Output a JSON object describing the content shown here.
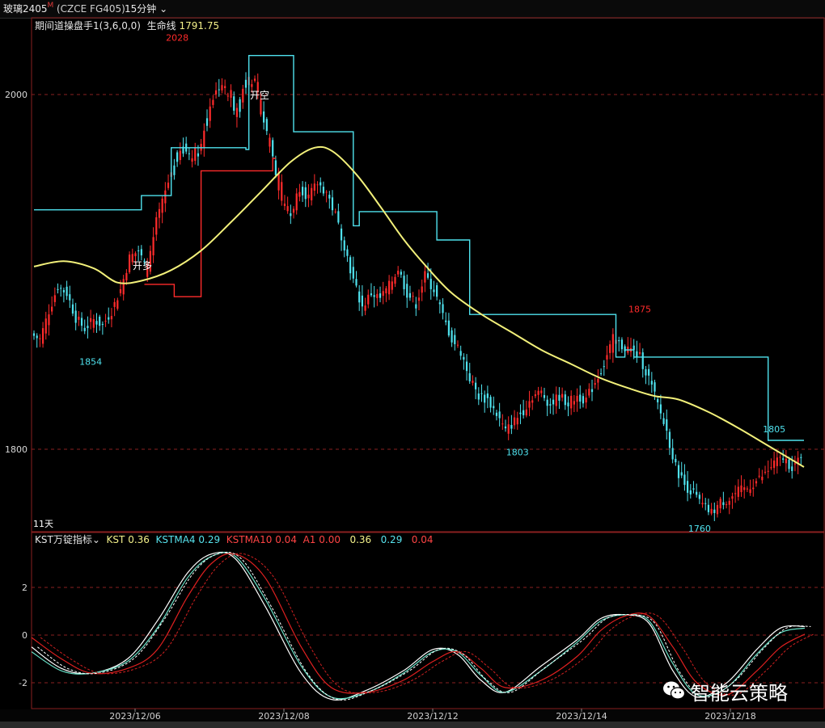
{
  "header": {
    "symbol": "玻璃2405",
    "symbol_mark": "M",
    "code": "(CZCE FG405)",
    "period": "15分钟"
  },
  "main_indicator": {
    "name": "期间道操盘手1(3,6,0,0)",
    "life_label": "生命线",
    "life_value": "1791.75"
  },
  "sub_indicator": {
    "name": "KST万锭指标",
    "kst_label": "KST",
    "kst_value": "0.36",
    "kstma4_label": "KSTMA4",
    "kstma4_value": "0.29",
    "kstma10_label": "KSTMA10",
    "kstma10_value": "0.04",
    "a1_label": "A1",
    "a1_value": "0.00",
    "v1": "0.36",
    "v2": "0.29",
    "v3": "0.04"
  },
  "labels": {
    "days": "11天",
    "open_long": "开多",
    "open_short": "开空"
  },
  "watermark": {
    "text": "智能云策略"
  },
  "colors": {
    "up": "#ff2b2b",
    "down": "#4fe2ee",
    "life": "#f2f07a",
    "kst": "#ffffff",
    "kstma4": "#68e2c8",
    "kstma10": "#e02020",
    "grid": "#8a2020"
  },
  "chart_data": [
    {
      "type": "candlestick",
      "y_ticks": [
        2000,
        1800
      ],
      "ylim": [
        1755,
        2035
      ],
      "x_ticks": [
        "2023/12/06",
        "2023/12/08",
        "2023/12/12",
        "2023/12/14",
        "2023/12/18"
      ],
      "annotations": [
        {
          "text": "2028",
          "value": 2028
        },
        {
          "text": "1854",
          "value": 1854
        },
        {
          "text": "1875",
          "value": 1875
        },
        {
          "text": "1803",
          "value": 1803
        },
        {
          "text": "1805",
          "value": 1805
        },
        {
          "text": "1760",
          "value": 1760
        }
      ],
      "close_path": [
        [
          0,
          1865
        ],
        [
          3,
          1862
        ],
        [
          6,
          1878
        ],
        [
          9,
          1892
        ],
        [
          12,
          1888
        ],
        [
          15,
          1874
        ],
        [
          18,
          1868
        ],
        [
          21,
          1873
        ],
        [
          24,
          1870
        ],
        [
          27,
          1878
        ],
        [
          30,
          1890
        ],
        [
          33,
          1908
        ],
        [
          36,
          1912
        ],
        [
          39,
          1900
        ],
        [
          42,
          1928
        ],
        [
          45,
          1945
        ],
        [
          48,
          1962
        ],
        [
          51,
          1970
        ],
        [
          54,
          1965
        ],
        [
          57,
          1972
        ],
        [
          60,
          1995
        ],
        [
          63,
          2005
        ],
        [
          66,
          2000
        ],
        [
          69,
          1990
        ],
        [
          72,
          2010
        ],
        [
          75,
          2005
        ],
        [
          78,
          1985
        ],
        [
          81,
          1965
        ],
        [
          84,
          1940
        ],
        [
          87,
          1932
        ],
        [
          90,
          1948
        ],
        [
          93,
          1942
        ],
        [
          96,
          1950
        ],
        [
          99,
          1945
        ],
        [
          102,
          1932
        ],
        [
          105,
          1915
        ],
        [
          108,
          1895
        ],
        [
          111,
          1880
        ],
        [
          114,
          1888
        ],
        [
          117,
          1885
        ],
        [
          120,
          1892
        ],
        [
          123,
          1902
        ],
        [
          126,
          1888
        ],
        [
          129,
          1882
        ],
        [
          132,
          1898
        ],
        [
          135,
          1890
        ],
        [
          138,
          1875
        ],
        [
          141,
          1862
        ],
        [
          144,
          1855
        ],
        [
          147,
          1840
        ],
        [
          150,
          1830
        ],
        [
          153,
          1828
        ],
        [
          156,
          1820
        ],
        [
          159,
          1810
        ],
        [
          162,
          1816
        ],
        [
          165,
          1822
        ],
        [
          168,
          1830
        ],
        [
          171,
          1832
        ],
        [
          174,
          1825
        ],
        [
          177,
          1830
        ],
        [
          180,
          1826
        ],
        [
          183,
          1830
        ],
        [
          186,
          1828
        ],
        [
          189,
          1838
        ],
        [
          192,
          1848
        ],
        [
          195,
          1862
        ],
        [
          198,
          1858
        ],
        [
          201,
          1856
        ],
        [
          204,
          1852
        ],
        [
          207,
          1840
        ],
        [
          210,
          1825
        ],
        [
          213,
          1810
        ],
        [
          216,
          1790
        ],
        [
          219,
          1780
        ],
        [
          222,
          1775
        ],
        [
          225,
          1768
        ],
        [
          228,
          1764
        ],
        [
          231,
          1770
        ],
        [
          234,
          1772
        ],
        [
          237,
          1776
        ],
        [
          240,
          1778
        ],
        [
          243,
          1782
        ],
        [
          246,
          1786
        ],
        [
          249,
          1792
        ],
        [
          252,
          1795
        ],
        [
          255,
          1790
        ],
        [
          258,
          1794
        ]
      ],
      "life_line": [
        [
          0,
          1903
        ],
        [
          10,
          1906
        ],
        [
          20,
          1902
        ],
        [
          28,
          1894
        ],
        [
          36,
          1895
        ],
        [
          46,
          1901
        ],
        [
          56,
          1912
        ],
        [
          66,
          1928
        ],
        [
          76,
          1945
        ],
        [
          86,
          1962
        ],
        [
          94,
          1970
        ],
        [
          100,
          1968
        ],
        [
          108,
          1955
        ],
        [
          116,
          1937
        ],
        [
          124,
          1918
        ],
        [
          132,
          1902
        ],
        [
          140,
          1888
        ],
        [
          150,
          1876
        ],
        [
          160,
          1866
        ],
        [
          170,
          1856
        ],
        [
          180,
          1848
        ],
        [
          190,
          1840
        ],
        [
          200,
          1834
        ],
        [
          208,
          1830
        ],
        [
          216,
          1828
        ],
        [
          226,
          1821
        ],
        [
          236,
          1812
        ],
        [
          246,
          1802
        ],
        [
          258,
          1790
        ]
      ],
      "stop_line": [
        [
          0,
          1935
        ],
        [
          36,
          1935
        ],
        [
          36,
          1943
        ],
        [
          46,
          1943
        ],
        [
          46,
          1970
        ],
        [
          71,
          1970
        ],
        [
          71,
          1969
        ],
        [
          72,
          1969
        ],
        [
          72,
          2022
        ],
        [
          87,
          2022
        ],
        [
          87,
          1979
        ],
        [
          107,
          1979
        ],
        [
          107,
          1926
        ],
        [
          109,
          1926
        ],
        [
          109,
          1934
        ],
        [
          135,
          1934
        ],
        [
          135,
          1918
        ],
        [
          146,
          1918
        ],
        [
          146,
          1876
        ],
        [
          195,
          1876
        ],
        [
          195,
          1852
        ],
        [
          198,
          1852
        ],
        [
          198,
          1856
        ],
        [
          201,
          1856
        ],
        [
          201,
          1852
        ],
        [
          246,
          1852
        ],
        [
          246,
          1805
        ],
        [
          258,
          1805
        ]
      ],
      "long_stop": [
        [
          37,
          1893
        ],
        [
          47,
          1893
        ],
        [
          47,
          1886
        ],
        [
          56,
          1886
        ],
        [
          56,
          1957
        ],
        [
          80,
          1957
        ],
        [
          80,
          1964
        ],
        [
          81,
          1964
        ]
      ]
    },
    {
      "type": "line",
      "y_ticks": [
        2,
        0,
        -2
      ],
      "ylim": [
        -2.9,
        3.6
      ],
      "series": [
        {
          "name": "KST",
          "values": [
            [
              0,
              -0.5
            ],
            [
              10,
              -1.4
            ],
            [
              20,
              -1.6
            ],
            [
              32,
              -1.0
            ],
            [
              42,
              0.6
            ],
            [
              52,
              2.6
            ],
            [
              60,
              3.4
            ],
            [
              68,
              3.2
            ],
            [
              78,
              1.2
            ],
            [
              90,
              -1.6
            ],
            [
              100,
              -2.7
            ],
            [
              112,
              -2.3
            ],
            [
              124,
              -1.5
            ],
            [
              134,
              -0.6
            ],
            [
              142,
              -0.8
            ],
            [
              150,
              -1.9
            ],
            [
              158,
              -2.4
            ],
            [
              170,
              -1.3
            ],
            [
              182,
              -0.2
            ],
            [
              190,
              0.7
            ],
            [
              198,
              0.85
            ],
            [
              206,
              0.5
            ],
            [
              214,
              -1.5
            ],
            [
              222,
              -2.6
            ],
            [
              232,
              -2.0
            ],
            [
              242,
              -0.6
            ],
            [
              250,
              0.3
            ],
            [
              258,
              0.36
            ]
          ]
        },
        {
          "name": "KSTMA4",
          "values": [
            [
              0,
              -0.7
            ],
            [
              10,
              -1.5
            ],
            [
              20,
              -1.6
            ],
            [
              32,
              -1.1
            ],
            [
              42,
              0.3
            ],
            [
              52,
              2.4
            ],
            [
              60,
              3.3
            ],
            [
              68,
              3.3
            ],
            [
              78,
              1.5
            ],
            [
              90,
              -1.3
            ],
            [
              100,
              -2.6
            ],
            [
              112,
              -2.4
            ],
            [
              124,
              -1.6
            ],
            [
              134,
              -0.7
            ],
            [
              142,
              -0.7
            ],
            [
              150,
              -1.7
            ],
            [
              158,
              -2.4
            ],
            [
              170,
              -1.5
            ],
            [
              182,
              -0.3
            ],
            [
              190,
              0.6
            ],
            [
              198,
              0.85
            ],
            [
              206,
              0.6
            ],
            [
              214,
              -1.2
            ],
            [
              222,
              -2.5
            ],
            [
              232,
              -2.2
            ],
            [
              242,
              -0.8
            ],
            [
              250,
              0.1
            ],
            [
              258,
              0.29
            ]
          ]
        },
        {
          "name": "KSTMA10",
          "values": [
            [
              0,
              -0.1
            ],
            [
              10,
              -1.0
            ],
            [
              20,
              -1.6
            ],
            [
              32,
              -1.4
            ],
            [
              42,
              -0.6
            ],
            [
              52,
              1.6
            ],
            [
              60,
              3.0
            ],
            [
              68,
              3.4
            ],
            [
              78,
              2.4
            ],
            [
              90,
              -0.5
            ],
            [
              100,
              -2.2
            ],
            [
              112,
              -2.4
            ],
            [
              124,
              -1.9
            ],
            [
              134,
              -1.1
            ],
            [
              142,
              -0.7
            ],
            [
              150,
              -1.4
            ],
            [
              158,
              -2.2
            ],
            [
              170,
              -1.9
            ],
            [
              182,
              -0.9
            ],
            [
              190,
              0.2
            ],
            [
              198,
              0.8
            ],
            [
              206,
              0.8
            ],
            [
              214,
              -0.5
            ],
            [
              222,
              -2.0
            ],
            [
              232,
              -2.5
            ],
            [
              242,
              -1.5
            ],
            [
              250,
              -0.5
            ],
            [
              258,
              0.04
            ]
          ]
        }
      ]
    }
  ]
}
